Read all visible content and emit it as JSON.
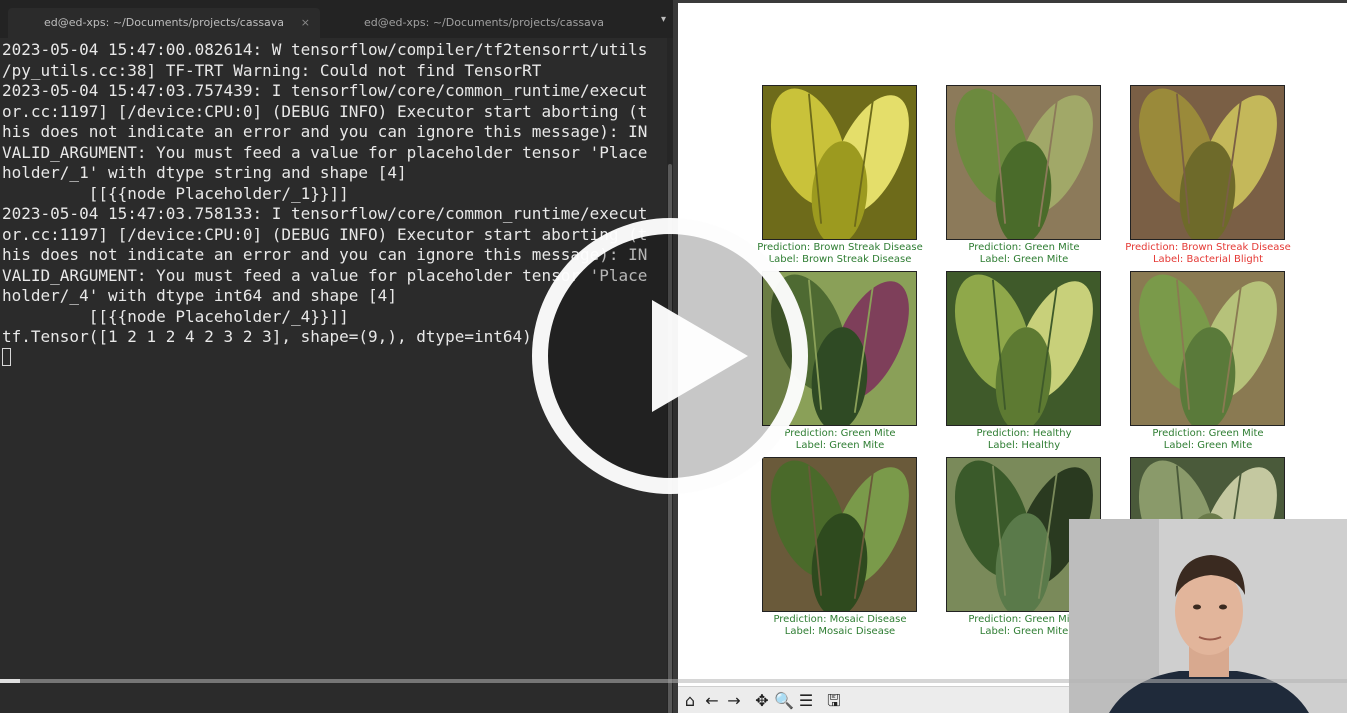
{
  "terminal": {
    "tabs": [
      {
        "title": "ed@ed-xps: ~/Documents/projects/cassava",
        "close": "×"
      },
      {
        "title": "ed@ed-xps: ~/Documents/projects/cassava",
        "close": "×"
      }
    ],
    "tab_menu": "▾",
    "lines": [
      "2023-05-04 15:47:00.082614: W tensorflow/compiler/tf2tensorrt/utils",
      "/py_utils.cc:38] TF-TRT Warning: Could not find TensorRT",
      "2023-05-04 15:47:03.757439: I tensorflow/core/common_runtime/execut",
      "or.cc:1197] [/device:CPU:0] (DEBUG INFO) Executor start aborting (t",
      "his does not indicate an error and you can ignore this message): IN",
      "VALID_ARGUMENT: You must feed a value for placeholder tensor 'Place",
      "holder/_1' with dtype string and shape [4]",
      "         [[{{node Placeholder/_1}}]]",
      "2023-05-04 15:47:03.758133: I tensorflow/core/common_runtime/execut",
      "or.cc:1197] [/device:CPU:0] (DEBUG INFO) Executor start aborting (t",
      "his does not indicate an error and you can ignore this message): IN",
      "VALID_ARGUMENT: You must feed a value for placeholder tensor 'Place",
      "holder/_4' with dtype int64 and shape [4]",
      "         [[{{node Placeholder/_4}}]]",
      "tf.Tensor([1 2 1 2 4 2 3 2 3], shape=(9,), dtype=int64)"
    ]
  },
  "figure": {
    "cells": [
      {
        "prediction": "Prediction: Brown Streak Disease",
        "label": "Label: Brown Streak Disease",
        "correct": true
      },
      {
        "prediction": "Prediction: Green Mite",
        "label": "Label: Green Mite",
        "correct": true
      },
      {
        "prediction": "Prediction: Brown Streak Disease",
        "label": "Label: Bacterial Blight",
        "correct": false
      },
      {
        "prediction": "Prediction: Green Mite",
        "label": "Label: Green Mite",
        "correct": true
      },
      {
        "prediction": "Prediction: Healthy",
        "label": "Label: Healthy",
        "correct": true
      },
      {
        "prediction": "Prediction: Green Mite",
        "label": "Label: Green Mite",
        "correct": true
      },
      {
        "prediction": "Prediction: Mosaic Disease",
        "label": "Label: Mosaic Disease",
        "correct": true
      },
      {
        "prediction": "Prediction: Green Mite",
        "label": "Label: Green Mite",
        "correct": true
      },
      {
        "prediction": "",
        "label": "",
        "correct": true
      }
    ],
    "toolbar": [
      {
        "name": "home-icon",
        "glyph": "⌂"
      },
      {
        "name": "back-arrow-icon",
        "glyph": "←"
      },
      {
        "name": "forward-arrow-icon",
        "glyph": "→"
      },
      {
        "name": "pan-icon",
        "glyph": "✥"
      },
      {
        "name": "zoom-icon",
        "glyph": "🔍"
      },
      {
        "name": "configure-subplots-icon",
        "glyph": "☰"
      },
      {
        "name": "save-icon",
        "glyph": "🖫"
      }
    ]
  },
  "player": {
    "progress": 0.015
  },
  "colors": {
    "correct": "#2e7d32",
    "incorrect": "#e53935",
    "terminal_bg": "#2b2b2b"
  }
}
